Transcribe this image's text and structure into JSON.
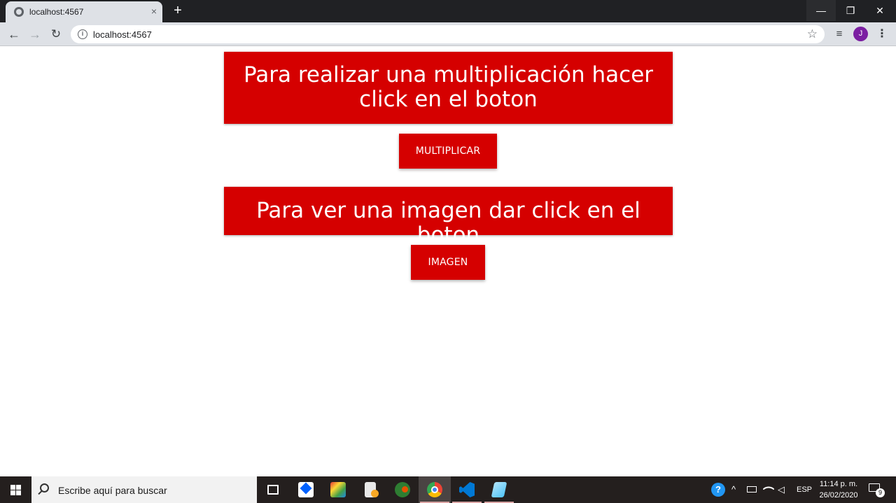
{
  "browser": {
    "tab_title": "localhost:4567",
    "tab_close": "×",
    "new_tab": "+",
    "window_controls": {
      "minimize": "—",
      "maximize": "❐",
      "close": "✕"
    },
    "nav": {
      "back": "←",
      "forward": "→",
      "reload": "↻"
    },
    "address": "localhost:4567",
    "info_icon": "i",
    "bookmark_star": "☆",
    "media_icon": "≡",
    "profile_initial": "J",
    "menu_icon": "⋮"
  },
  "page": {
    "banner_multiply": "Para realizar una multiplicación hacer click en el boton",
    "button_multiply": "MULTIPLICAR",
    "banner_image": "Para ver una imagen dar click en el boton",
    "button_image": "IMAGEN"
  },
  "taskbar": {
    "search_placeholder": "Escribe aquí para buscar",
    "language": "ESP",
    "time": "11:14 p. m.",
    "date": "26/02/2020",
    "notification_count": "9",
    "apps": [
      "task-view",
      "dropbox",
      "photo-app",
      "file-app",
      "network-app",
      "chrome",
      "vscode",
      "notes-app"
    ]
  },
  "colors": {
    "accent_red": "#d50000",
    "chrome_dark": "#202124",
    "taskbar": "#241f1e"
  }
}
